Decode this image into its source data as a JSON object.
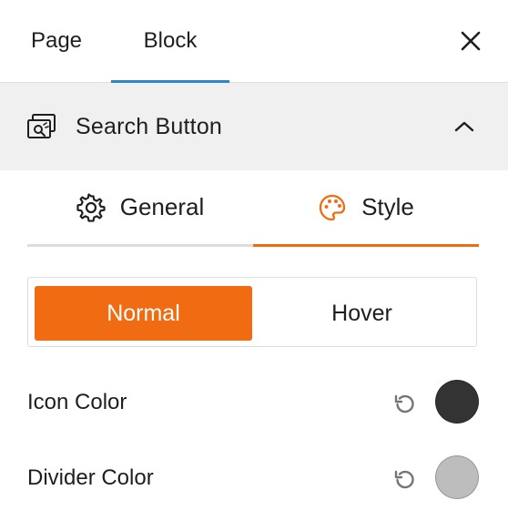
{
  "top_tabs": {
    "page": "Page",
    "block": "Block"
  },
  "block_panel": {
    "title": "Search Button"
  },
  "sub_tabs": {
    "general": "General",
    "style": "Style"
  },
  "state_toggle": {
    "normal": "Normal",
    "hover": "Hover",
    "selected": "Normal"
  },
  "color_settings": [
    {
      "label": "Icon Color",
      "color": "#333333"
    },
    {
      "label": "Divider Color",
      "color": "#bdbdbd"
    }
  ],
  "colors": {
    "accent": "#f06b11",
    "tab_indicator": "#2e86c9",
    "header_bg": "#f0f0f0"
  },
  "icons": [
    "close-icon",
    "search-block-icon",
    "chevron-up-icon",
    "gear-icon",
    "palette-icon",
    "reset-icon"
  ]
}
